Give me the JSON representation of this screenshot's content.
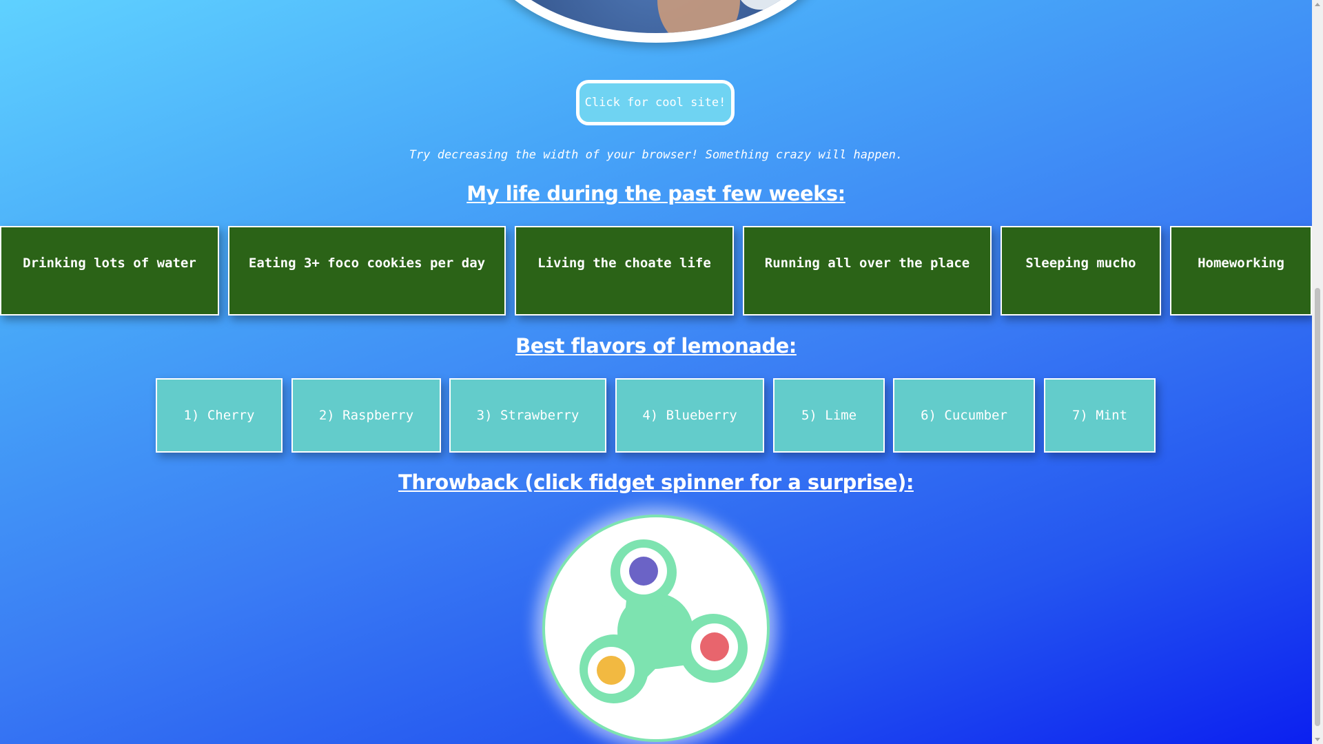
{
  "cool_button": {
    "label": "Click for cool site!"
  },
  "hint": "Try decreasing the width of your browser! Something crazy will happen.",
  "life_section": {
    "title": "My life during the past few weeks:",
    "items": [
      "Drinking lots of water",
      "Eating 3+ foco cookies per day",
      "Living the choate life",
      "Running all over the place",
      "Sleeping mucho",
      "Homeworking"
    ]
  },
  "lemonade_section": {
    "title": "Best flavors of lemonade:",
    "items": [
      "1) Cherry",
      "2) Raspberry",
      "3) Strawberry",
      "4) Blueberry",
      "5) Lime",
      "6) Cucumber",
      "7) Mint"
    ]
  },
  "throwback_section": {
    "title": "Throwback (click fidget spinner for a surprise):",
    "spinner_icon": "fidget-spinner-icon"
  },
  "colors": {
    "life_card": "#2b6317",
    "lemon_card": "#63cccb",
    "button": "#6fd3f2",
    "spinner_body": "#7de3b0"
  }
}
